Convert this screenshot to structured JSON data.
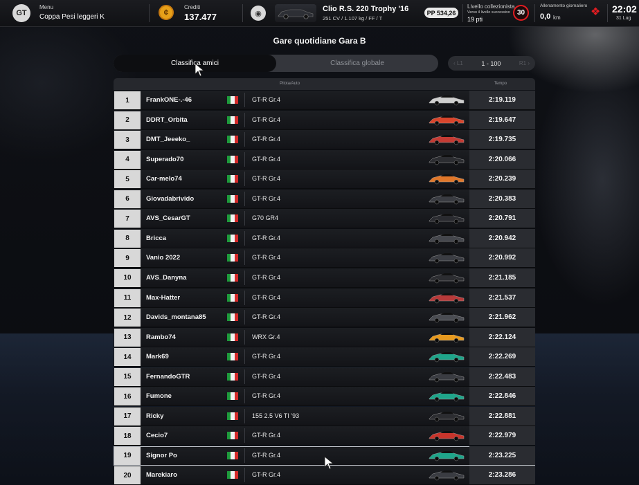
{
  "topbar": {
    "menu_label": "Menu",
    "event_name": "Coppa Pesi leggeri K",
    "credits_label": "Crediti",
    "credits_value": "137.477",
    "car_name": "Clio R.S. 220 Trophy '16",
    "car_specs": "251 CV / 1.107 kg / FF / T",
    "pp_value": "PP 534,26",
    "collector_label": "Livello collezionista",
    "collector_sub": "Verso il livello successivo",
    "collector_points": "19 pti",
    "collector_level": "30",
    "training_label": "Allenamento giornaliero",
    "training_value": "0,0",
    "training_unit": "km",
    "clock_time": "22:02",
    "clock_date": "31 Lug"
  },
  "page_title": "Gare quotidiane Gara B",
  "tabs": [
    {
      "label": "Classifica amici",
      "active": true
    },
    {
      "label": "Classifica globale",
      "active": false
    }
  ],
  "pager": {
    "range": "1 - 100",
    "prev_hint": "L1",
    "next_hint": "R1"
  },
  "table": {
    "col_driver": "Pilota/Auto",
    "col_time": "Tempo",
    "rows": [
      {
        "pos": "1",
        "name": "FrankONE-.-46",
        "car": "GT-R Gr.4",
        "time": "2:19.119",
        "car_color": "#cfcfcf"
      },
      {
        "pos": "2",
        "name": "DDRT_Orbita",
        "car": "GT-R Gr.4",
        "time": "2:19.647",
        "car_color": "#d8452c"
      },
      {
        "pos": "3",
        "name": "DMT_Jeeeko_",
        "car": "GT-R Gr.4",
        "time": "2:19.735",
        "car_color": "#c43b34"
      },
      {
        "pos": "4",
        "name": "Superado70",
        "car": "GT-R Gr.4",
        "time": "2:20.066",
        "car_color": "#2c2d31"
      },
      {
        "pos": "5",
        "name": "Car-melo74",
        "car": "GT-R Gr.4",
        "time": "2:20.239",
        "car_color": "#e0772a"
      },
      {
        "pos": "6",
        "name": "Giovadabrivido",
        "car": "GT-R Gr.4",
        "time": "2:20.383",
        "car_color": "#3a3c42"
      },
      {
        "pos": "7",
        "name": "AVS_CesarGT",
        "car": "G70 GR4",
        "time": "2:20.791",
        "car_color": "#2a2b30"
      },
      {
        "pos": "8",
        "name": "Bricca",
        "car": "GT-R Gr.4",
        "time": "2:20.942",
        "car_color": "#44464c"
      },
      {
        "pos": "9",
        "name": "Vanio 2022",
        "car": "GT-R Gr.4",
        "time": "2:20.992",
        "car_color": "#3b3d43"
      },
      {
        "pos": "10",
        "name": "AVS_Danyna",
        "car": "GT-R Gr.4",
        "time": "2:21.185",
        "car_color": "#2c2d31"
      },
      {
        "pos": "11",
        "name": "Max-Hatter",
        "car": "GT-R Gr.4",
        "time": "2:21.537",
        "car_color": "#b73a3a"
      },
      {
        "pos": "12",
        "name": "Davids_montana85",
        "car": "GT-R Gr.4",
        "time": "2:21.962",
        "car_color": "#4a4c52"
      },
      {
        "pos": "13",
        "name": "Rambo74",
        "car": "WRX Gr.4",
        "time": "2:22.124",
        "car_color": "#e79a1f"
      },
      {
        "pos": "14",
        "name": "Mark69",
        "car": "GT-R Gr.4",
        "time": "2:22.269",
        "car_color": "#1fa58a"
      },
      {
        "pos": "15",
        "name": "FernandoGTR",
        "car": "GT-R Gr.4",
        "time": "2:22.483",
        "car_color": "#3a3c42"
      },
      {
        "pos": "16",
        "name": "Fumone",
        "car": "GT-R Gr.4",
        "time": "2:22.846",
        "car_color": "#1fa58a"
      },
      {
        "pos": "17",
        "name": "Ricky",
        "car": "155 2.5 V6 TI '93",
        "time": "2:22.881",
        "car_color": "#2c2d31"
      },
      {
        "pos": "18",
        "name": "Cecio7",
        "car": "GT-R Gr.4",
        "time": "2:22.979",
        "car_color": "#c8352c"
      },
      {
        "pos": "19",
        "name": "Signor Po",
        "car": "GT-R Gr.4",
        "time": "2:23.225",
        "car_color": "#1fa58a",
        "selected": true
      },
      {
        "pos": "20",
        "name": "Marekiaro",
        "car": "GT-R Gr.4",
        "time": "2:23.286",
        "car_color": "#3a3c42"
      }
    ]
  },
  "flag_colors": {
    "green": "#1e9a3c",
    "white": "#f2f2f2",
    "red": "#d42a2a"
  }
}
